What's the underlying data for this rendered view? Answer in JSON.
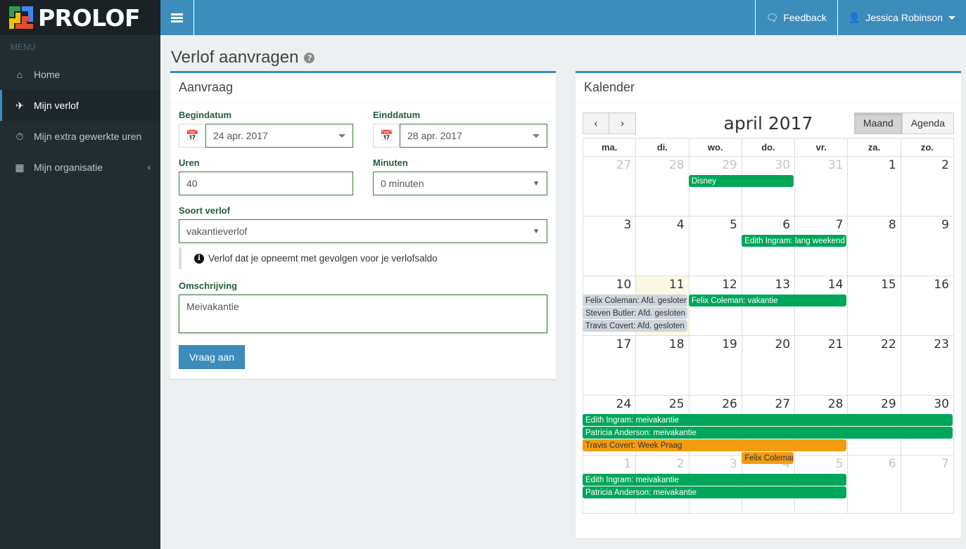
{
  "brand": {
    "name": "PROLOF",
    "menu_label": "MENU"
  },
  "sidebar": {
    "items": [
      {
        "label": "Home",
        "icon": "home-icon",
        "glyph": "⌂",
        "active": false,
        "arrow": ""
      },
      {
        "label": "Mijn verlof",
        "icon": "plane-icon",
        "glyph": "✈",
        "active": true,
        "arrow": ""
      },
      {
        "label": "Mijn extra gewerkte uren",
        "icon": "clock-icon",
        "glyph": "◴",
        "active": false,
        "arrow": ""
      },
      {
        "label": "Mijn organisatie",
        "icon": "building-icon",
        "glyph": "▦",
        "active": false,
        "arrow": "‹"
      }
    ]
  },
  "navbar": {
    "toggle_icon": "hamburger-icon",
    "feedback_label": "Feedback",
    "feedback_icon": "comments-icon",
    "user_name": "Jessica Robinson",
    "user_icon": "user-icon"
  },
  "page": {
    "title": "Verlof aanvragen",
    "help_icon": "question-mark-icon"
  },
  "form": {
    "box_title": "Aanvraag",
    "begindatum_label": "Begindatum",
    "begindatum_value": "24 apr. 2017",
    "einddatum_label": "Einddatum",
    "einddatum_value": "28 apr. 2017",
    "uren_label": "Uren",
    "uren_value": "40",
    "minuten_label": "Minuten",
    "minuten_value": "0 minuten",
    "soort_label": "Soort verlof",
    "soort_value": "vakantieverlof",
    "hint": "Verlof dat je opneemt met gevolgen voor je verlofsaldo",
    "omschrijving_label": "Omschrijving",
    "omschrijving_value": "Meivakantie",
    "submit_label": "Vraag aan",
    "calendar_icon": "calendar-icon"
  },
  "calendar": {
    "box_title": "Kalender",
    "prev_label": "‹",
    "next_label": "›",
    "month_title": "april 2017",
    "view_month_label": "Maand",
    "view_agenda_label": "Agenda",
    "active_view": "Maand",
    "day_headers": [
      "ma.",
      "di.",
      "wo.",
      "do.",
      "vr.",
      "za.",
      "zo."
    ],
    "weeks": [
      {
        "days": [
          {
            "n": "27",
            "other": true
          },
          {
            "n": "28",
            "other": true
          },
          {
            "n": "29",
            "other": true
          },
          {
            "n": "30",
            "other": true
          },
          {
            "n": "31",
            "other": true
          },
          {
            "n": "1",
            "other": false
          },
          {
            "n": "2",
            "other": false
          }
        ],
        "events": [
          {
            "title": "Disney",
            "color": "green",
            "start": 2,
            "span": 2,
            "row": 0
          }
        ]
      },
      {
        "days": [
          {
            "n": "3"
          },
          {
            "n": "4"
          },
          {
            "n": "5"
          },
          {
            "n": "6"
          },
          {
            "n": "7"
          },
          {
            "n": "8"
          },
          {
            "n": "9"
          }
        ],
        "events": [
          {
            "title": "Edith Ingram: lang weekend",
            "color": "green",
            "start": 3,
            "span": 2,
            "row": 0
          }
        ]
      },
      {
        "days": [
          {
            "n": "10"
          },
          {
            "n": "11",
            "today": true
          },
          {
            "n": "12"
          },
          {
            "n": "13"
          },
          {
            "n": "14"
          },
          {
            "n": "15"
          },
          {
            "n": "16"
          }
        ],
        "events": [
          {
            "title": "Felix Coleman: Afd. gesloten",
            "color": "gray",
            "start": 0,
            "span": 2,
            "row": 0
          },
          {
            "title": "Felix Coleman: vakantie",
            "color": "green",
            "start": 2,
            "span": 3,
            "row": 0
          },
          {
            "title": "Steven Butler: Afd. gesloten",
            "color": "gray",
            "start": 0,
            "span": 2,
            "row": 1
          },
          {
            "title": "Travis Covert: Afd. gesloten",
            "color": "gray",
            "start": 0,
            "span": 2,
            "row": 2
          }
        ]
      },
      {
        "days": [
          {
            "n": "17"
          },
          {
            "n": "18"
          },
          {
            "n": "19"
          },
          {
            "n": "20"
          },
          {
            "n": "21"
          },
          {
            "n": "22"
          },
          {
            "n": "23"
          }
        ],
        "events": []
      },
      {
        "days": [
          {
            "n": "24"
          },
          {
            "n": "25"
          },
          {
            "n": "26"
          },
          {
            "n": "27"
          },
          {
            "n": "28"
          },
          {
            "n": "29"
          },
          {
            "n": "30"
          }
        ],
        "events": [
          {
            "title": "Edith Ingram: meivakantie",
            "color": "green",
            "start": 0,
            "span": 7,
            "row": 0
          },
          {
            "title": "Patricia Anderson: meivakantie",
            "color": "green",
            "start": 0,
            "span": 7,
            "row": 1
          },
          {
            "title": "Travis Covert: Week Praag",
            "color": "orange",
            "start": 0,
            "span": 5,
            "row": 2
          },
          {
            "title": "Felix Coleman",
            "color": "orange",
            "start": 3,
            "span": 1,
            "row": 3
          }
        ]
      },
      {
        "days": [
          {
            "n": "1",
            "other": true
          },
          {
            "n": "2",
            "other": true
          },
          {
            "n": "3",
            "other": true
          },
          {
            "n": "4",
            "other": true
          },
          {
            "n": "5",
            "other": true
          },
          {
            "n": "6",
            "other": true
          },
          {
            "n": "7",
            "other": true
          }
        ],
        "events": [
          {
            "title": "Edith Ingram: meivakantie",
            "color": "green",
            "start": 0,
            "span": 5,
            "row": 0
          },
          {
            "title": "Patricia Anderson: meivakantie",
            "color": "green",
            "start": 0,
            "span": 5,
            "row": 1
          }
        ]
      }
    ]
  },
  "colors": {
    "brand_blue": "#3c8dbc",
    "sidebar_dark": "#222d32",
    "event_green": "#00a65a",
    "event_orange": "#f39c12",
    "event_gray": "#cfd6dd",
    "label_green": "#22603a",
    "today_bg": "#fcf8e3"
  }
}
